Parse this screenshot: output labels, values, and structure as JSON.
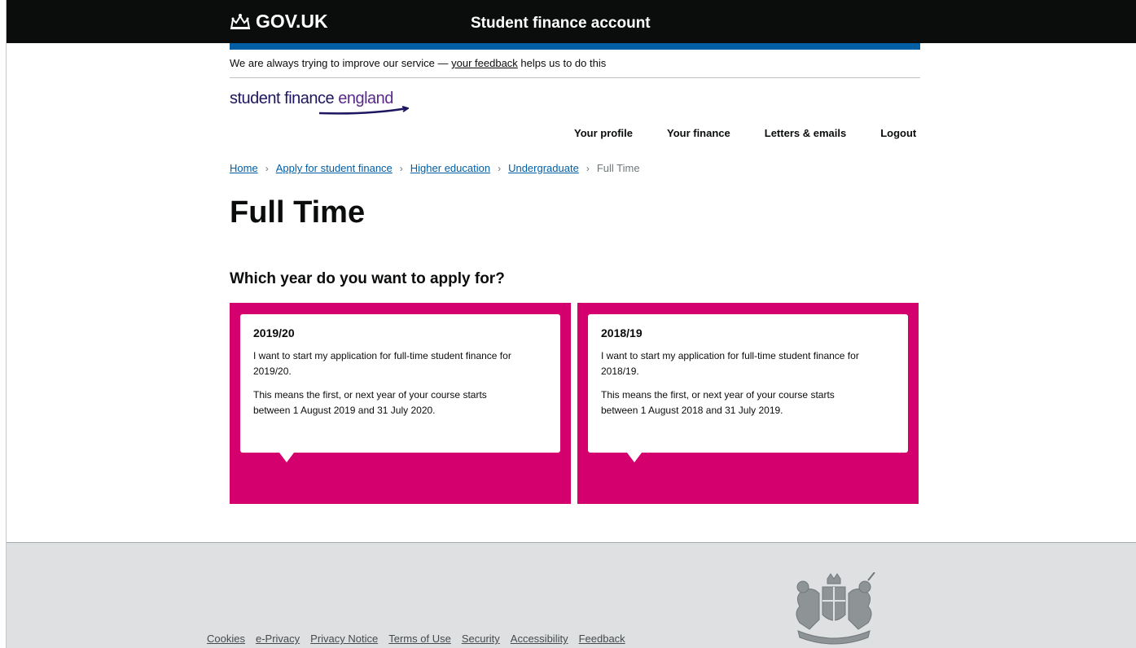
{
  "header": {
    "logo_text": "GOV.UK",
    "service_name": "Student finance account"
  },
  "feedback": {
    "prefix": "We are always trying to improve our service — ",
    "link": "your feedback",
    "suffix": " helps us to do this"
  },
  "brand": {
    "part1": "student finance ",
    "part2": "england"
  },
  "nav": {
    "items": [
      "Your profile",
      "Your finance",
      "Letters & emails",
      "Logout"
    ]
  },
  "breadcrumbs": {
    "links": [
      "Home",
      "Apply for student finance",
      "Higher education",
      "Undergraduate"
    ],
    "current": "Full Time"
  },
  "page_title": "Full Time",
  "question": "Which year do you want to apply for?",
  "options": [
    {
      "title": "2019/20",
      "line1": "I want to start my application for full-time student finance for 2019/20.",
      "line2": "This means the first, or next year of your course starts between 1 August 2019 and 31 July 2020."
    },
    {
      "title": "2018/19",
      "line1": "I want to start my application for full-time student finance for 2018/19.",
      "line2": "This means the first, or next year of your course starts between 1 August 2018 and 31 July 2019."
    }
  ],
  "footer": {
    "links": [
      "Cookies",
      "e-Privacy",
      "Privacy Notice",
      "Terms of Use",
      "Security",
      "Accessibility",
      "Feedback"
    ]
  },
  "colors": {
    "header_bg": "#0b0c0c",
    "accent_blue": "#005ea5",
    "card_magenta": "#d4006d",
    "footer_bg": "#dee0e2"
  }
}
